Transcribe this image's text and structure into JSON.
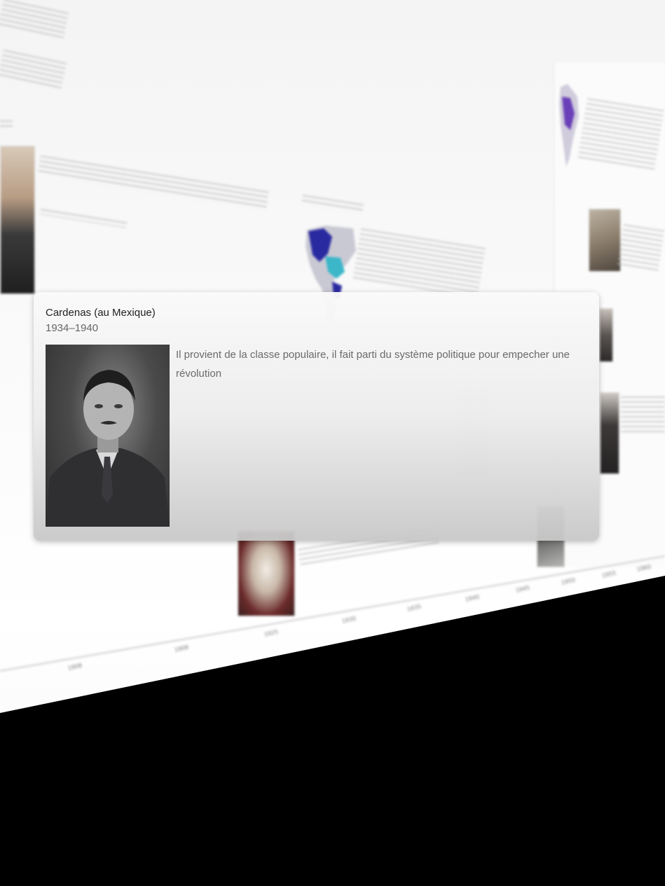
{
  "popup": {
    "title": "Cardenas (au Mexique)",
    "dates": "1934–1940",
    "description": "Il provient de la classe populaire, il fait parti du système politique pour empecher une révolution",
    "photo_icon": "portrait-photo-icon"
  },
  "timeline": {
    "axis_labels": [
      "1908",
      "1908",
      "1925",
      "1930",
      "1935",
      "1940",
      "1945",
      "1950",
      "1955",
      "1960"
    ]
  },
  "colors": {
    "background": "#000000",
    "plane": "#f7f7f7",
    "map_blue": "#2a2aa0",
    "map_cyan": "#3bb7c9",
    "map_purple": "#6a40b8"
  }
}
